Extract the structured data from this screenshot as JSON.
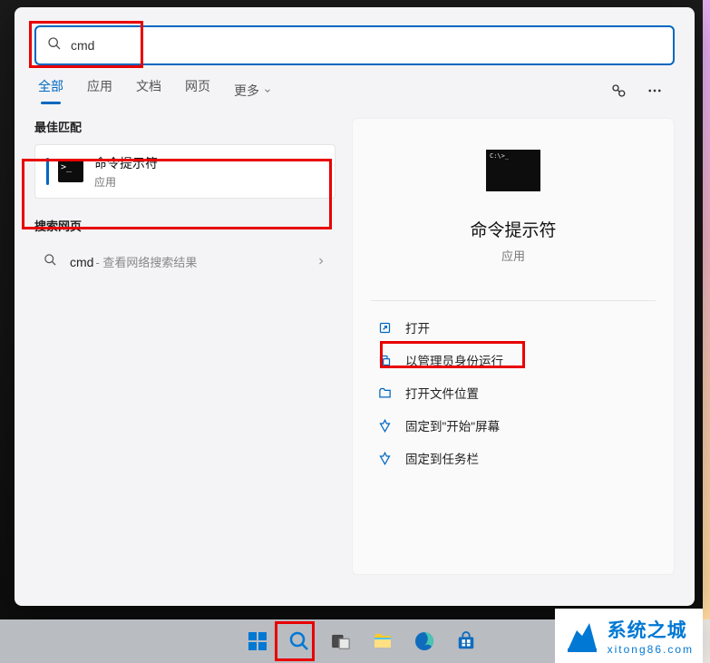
{
  "search": {
    "value": "cmd"
  },
  "filters": {
    "all": "全部",
    "apps": "应用",
    "docs": "文档",
    "web": "网页",
    "more": "更多"
  },
  "sections": {
    "best_match": "最佳匹配",
    "search_web": "搜索网页"
  },
  "result": {
    "title": "命令提示符",
    "sub": "应用",
    "icon_text": ">_"
  },
  "web": {
    "term": "cmd",
    "suffix": " - 查看网络搜索结果"
  },
  "preview": {
    "title": "命令提示符",
    "sub": "应用"
  },
  "actions": {
    "open": "打开",
    "admin": "以管理员身份运行",
    "location": "打开文件位置",
    "pin_start": "固定到\"开始\"屏幕",
    "pin_taskbar": "固定到任务栏"
  },
  "watermark": {
    "title": "系统之城",
    "url": "xitong86.com"
  }
}
